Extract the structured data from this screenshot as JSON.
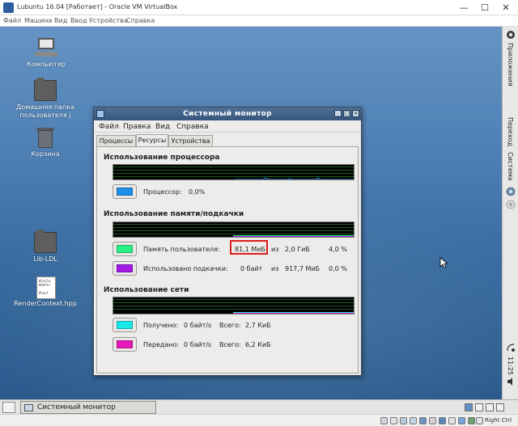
{
  "host": {
    "title": "Lubuntu 16.04 [Работает] - Oracle VM VirtualBox",
    "controls": {
      "minimize": "—",
      "maximize": "☐",
      "close": "✕"
    },
    "menu": [
      "Файл",
      "Машина",
      "Вид",
      "Ввод",
      "Устройства",
      "Справка"
    ],
    "status": {
      "host_key": "Right Ctrl"
    }
  },
  "desktop": {
    "icons": [
      {
        "label": "Компьютер",
        "kind": "computer"
      },
      {
        "label": "Домашняя папка пользователя j",
        "kind": "home-folder"
      },
      {
        "label": "Корзина",
        "kind": "trash"
      },
      {
        "label": "Lib-LDL",
        "kind": "folder"
      },
      {
        "label": "RenderContext.hpp",
        "kind": "document",
        "preview": "#inclu\n#defir\n\n#incl"
      }
    ]
  },
  "window": {
    "title": "Системный монитор",
    "menu": [
      "Файл",
      "Правка",
      "Вид",
      "Справка"
    ],
    "tabs": [
      {
        "label": "Процессы",
        "active": false
      },
      {
        "label": "Ресурсы",
        "active": true
      },
      {
        "label": "Устройства",
        "active": false
      }
    ],
    "cpu": {
      "title": "Использование процессора",
      "label": "Процессор:",
      "value": "0,0%",
      "color": "#1e8fe8"
    },
    "memory": {
      "title": "Использование памяти/подкачки",
      "user": {
        "label": "Память пользователя:",
        "used": "81,1 МиБ",
        "of_word": "из",
        "total": "2,0 ГиБ",
        "percent": "4,0 %",
        "color": "#29f084"
      },
      "swap": {
        "label": "Использовано подкачки:",
        "used": "0 байт",
        "of_word": "из",
        "total": "917,7 МиБ",
        "percent": "0,0 %",
        "color": "#a019e6"
      }
    },
    "network": {
      "title": "Использование сети",
      "received": {
        "label": "Получено:",
        "rate": "0 байт/s",
        "total_label": "Всего:",
        "total": "2,7 КиБ",
        "color": "#19e8e6"
      },
      "sent": {
        "label": "Передано:",
        "rate": "0 байт/s",
        "total_label": "Всего:",
        "total": "6,2 КиБ",
        "color": "#e619b8"
      }
    }
  },
  "guest_panel": {
    "vertical_items": [
      "Приложения",
      "Переход",
      "Система"
    ],
    "clock": "11:25"
  },
  "taskbar": {
    "task_label": "Системный монитор"
  }
}
